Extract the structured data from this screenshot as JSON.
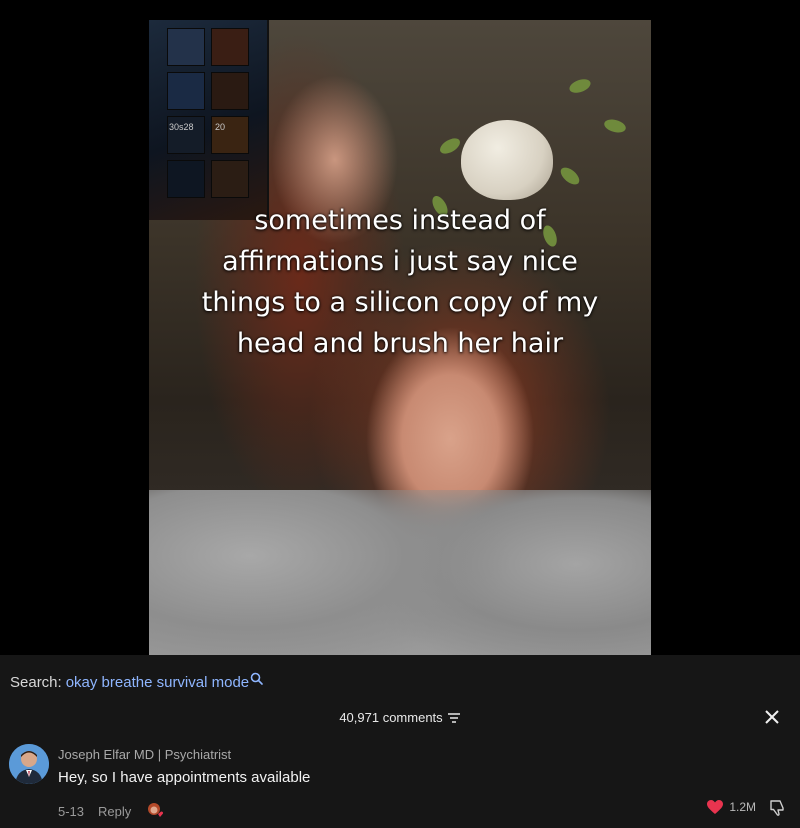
{
  "video": {
    "caption": "sometimes instead of affirmations i just say nice things to a silicon copy of my head and brush her hair",
    "poster_text_1": "30s28",
    "poster_text_2": "20"
  },
  "search": {
    "label": "Search:",
    "query": "okay breathe survival mode"
  },
  "comments": {
    "count_text": "40,971 comments",
    "items": [
      {
        "author": "Joseph Elfar MD | Psychiatrist",
        "text": "Hey, so I have appointments available",
        "date": "5-13",
        "reply_label": "Reply",
        "likes": "1.2M"
      }
    ]
  },
  "colors": {
    "panel_bg": "#161616",
    "search_query": "#8fb6ff",
    "like_heart": "#e8344f"
  },
  "icons": {
    "search": "search-icon",
    "filter": "filter-icon",
    "close": "close-icon",
    "like": "heart-icon",
    "dislike": "thumbs-down-icon"
  }
}
